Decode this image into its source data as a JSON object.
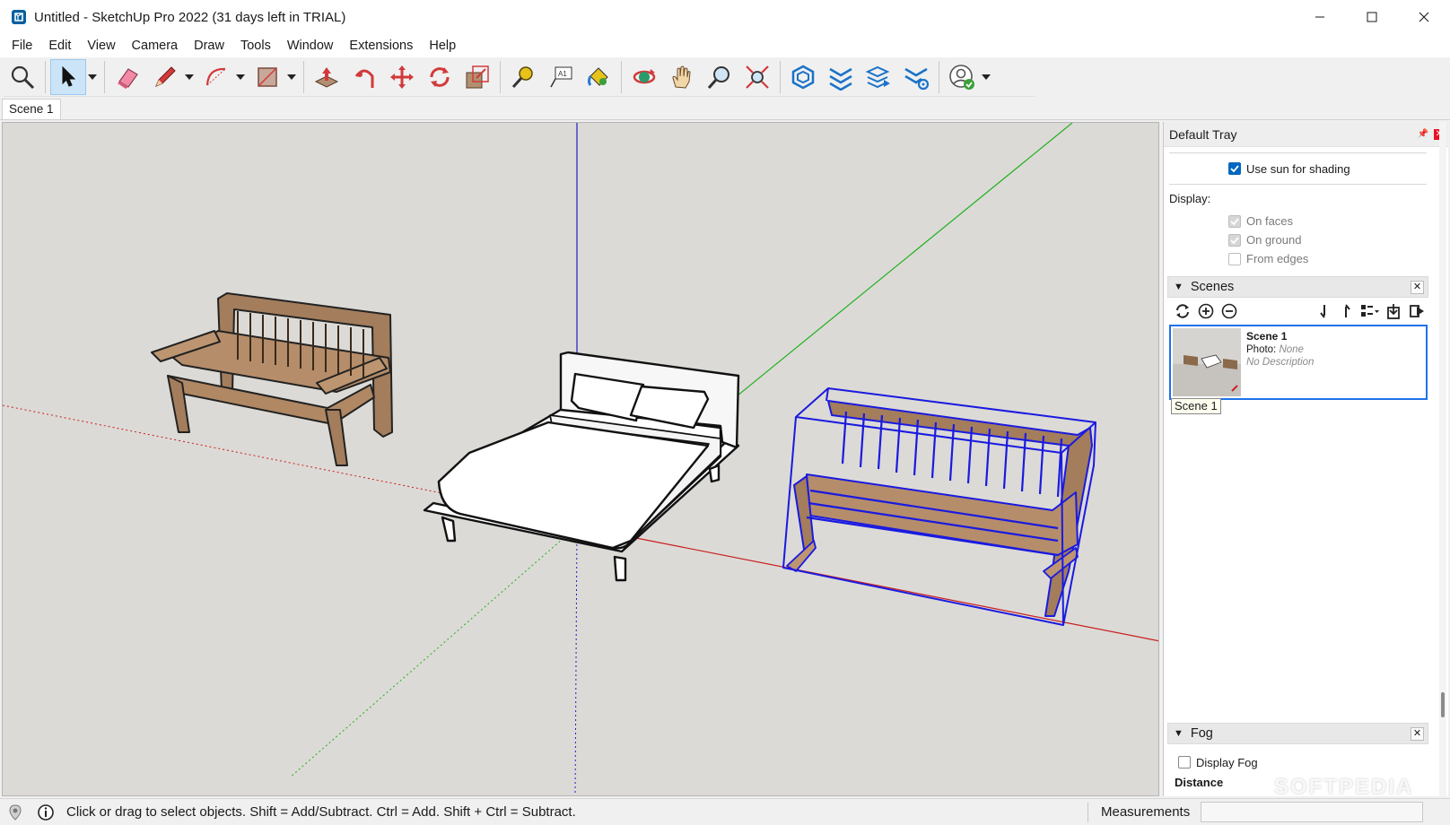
{
  "window": {
    "title": "Untitled - SketchUp Pro 2022 (31 days left in TRIAL)",
    "controls": [
      "minimize",
      "maximize",
      "close"
    ]
  },
  "menu": [
    "File",
    "Edit",
    "View",
    "Camera",
    "Draw",
    "Tools",
    "Window",
    "Extensions",
    "Help"
  ],
  "toolbar": {
    "tools": [
      "search-tool",
      "select-tool",
      "eraser-tool",
      "pencil-tool",
      "arc-tool",
      "shape-tool",
      "push-pull-tool",
      "follow-me-tool",
      "move-tool",
      "rotate-tool",
      "scale-tool",
      "tape-measure-tool",
      "text-tool",
      "paint-bucket-tool",
      "orbit-tool",
      "pan-tool",
      "zoom-tool",
      "zoom-extents-tool",
      "warehouse-tool",
      "extension-warehouse-tool",
      "layout-tool",
      "extension-manager-tool",
      "account-tool"
    ]
  },
  "scene_tabs": [
    "Scene 1"
  ],
  "tray": {
    "title": "Default Tray",
    "shadows": {
      "use_sun_label": "Use sun for shading",
      "use_sun_checked": true,
      "display_label": "Display:",
      "options": [
        {
          "label": "On faces",
          "checked": true,
          "disabled": true
        },
        {
          "label": "On ground",
          "checked": true,
          "disabled": true
        },
        {
          "label": "From edges",
          "checked": false,
          "disabled": true
        }
      ]
    },
    "scenes": {
      "title": "Scenes",
      "item": {
        "name": "Scene 1",
        "photo_label": "Photo:",
        "photo_value": "None",
        "description": "No Description",
        "tooltip": "Scene 1"
      }
    },
    "fog": {
      "title": "Fog",
      "display_label": "Display Fog",
      "display_checked": false,
      "distance_label": "Distance"
    }
  },
  "status": {
    "hint": "Click or drag to select objects. Shift = Add/Subtract. Ctrl = Add. Shift + Ctrl = Subtract.",
    "measurements_label": "Measurements",
    "measurements_value": ""
  },
  "watermark": "SOFTPEDIA",
  "colors": {
    "viewport_bg": "#dcdad6",
    "selection_blue": "#1a1ae0",
    "axis_red": "#c81e1e",
    "axis_green": "#1fb01f",
    "axis_blue": "#2020c0",
    "wood": "#a37d5c",
    "accent": "#0067c0"
  }
}
